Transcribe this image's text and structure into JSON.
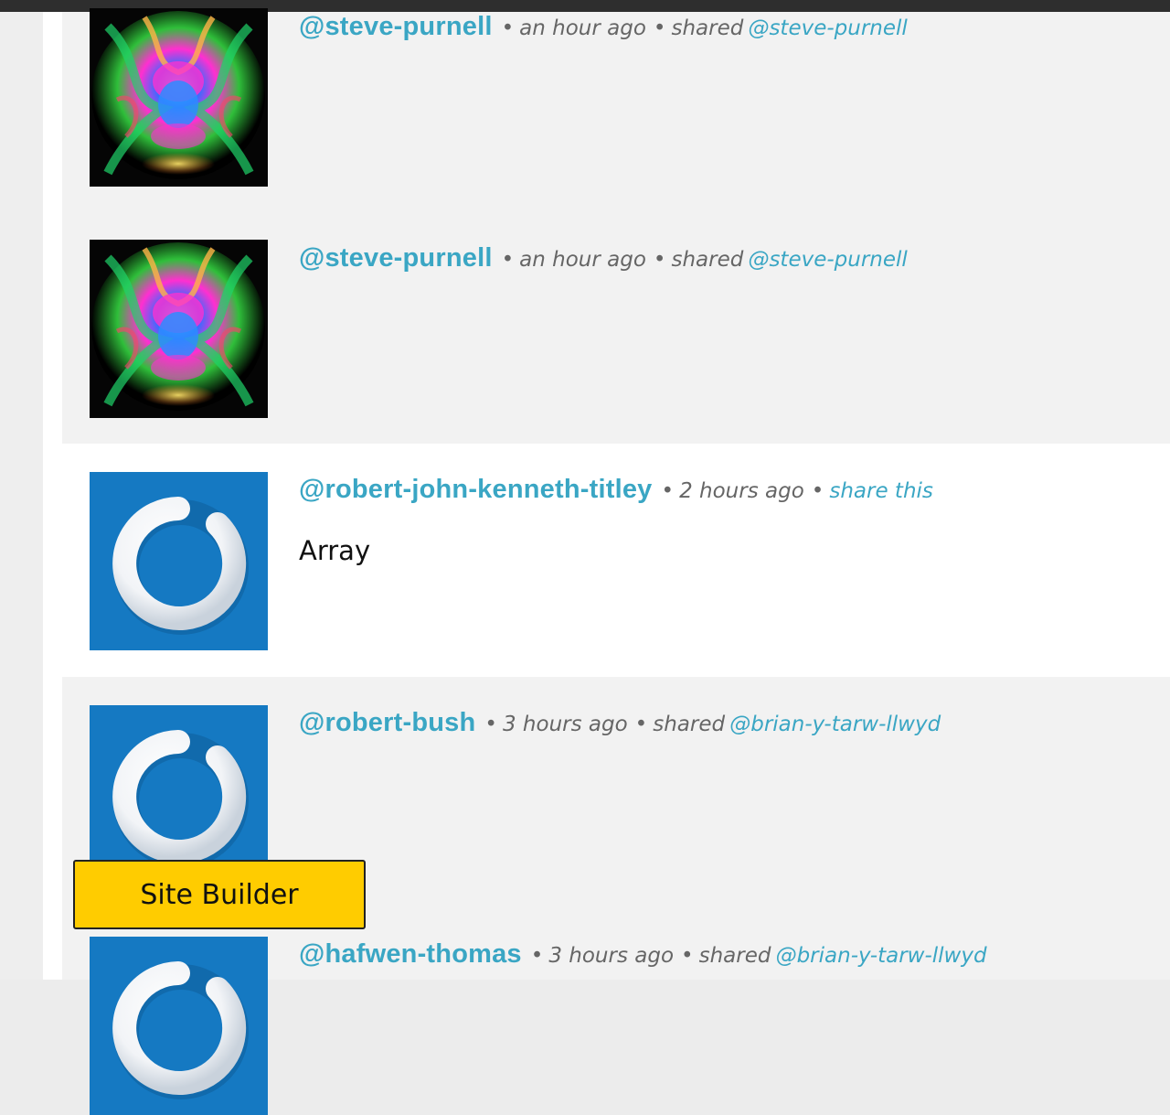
{
  "feed": {
    "items": [
      {
        "handle": "@steve-purnell",
        "time": "an hour ago",
        "action": "shared",
        "link": "@steve-purnell",
        "body": "",
        "avatar": "smoke-art-avatar"
      },
      {
        "handle": "@steve-purnell",
        "time": "an hour ago",
        "action": "shared",
        "link": "@steve-purnell",
        "body": "",
        "avatar": "smoke-art-avatar"
      },
      {
        "handle": "@robert-john-kenneth-titley",
        "time": "2 hours ago",
        "action": "",
        "link": "share this",
        "body": "Array",
        "avatar": "gravatar-default-avatar"
      },
      {
        "handle": "@robert-bush",
        "time": "3 hours ago",
        "action": "shared",
        "link": "@brian-y-tarw-llwyd",
        "body": "",
        "avatar": "gravatar-default-avatar"
      },
      {
        "handle": "@hafwen-thomas",
        "time": "3 hours ago",
        "action": "shared",
        "link": "@brian-y-tarw-llwyd",
        "body": "",
        "avatar": "gravatar-default-avatar"
      }
    ],
    "separator": "•"
  },
  "site_builder": {
    "label": "Site Builder"
  },
  "colors": {
    "link": "#3aa6c4",
    "meta": "#666666",
    "shared_bg": "#f2f2f2",
    "own_bg": "#ffffff",
    "gravatar_blue": "#1579c2",
    "site_builder_bg": "#ffcc00",
    "topbar": "#2e2e2e"
  }
}
